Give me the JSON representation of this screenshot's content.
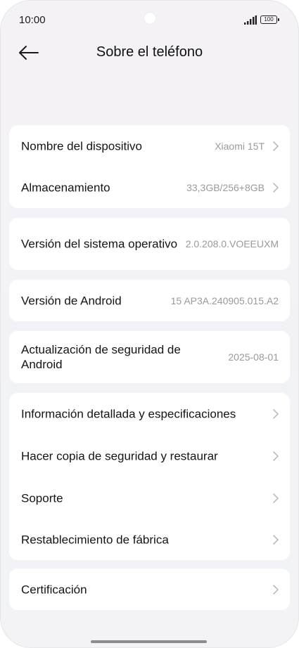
{
  "status": {
    "time": "10:00",
    "battery": "100"
  },
  "header": {
    "title": "Sobre el teléfono"
  },
  "card1": {
    "rows": [
      {
        "label": "Nombre del dispositivo",
        "value": "Xiaomi 15T"
      },
      {
        "label": "Almacenamiento",
        "value": "33,3GB/256+8GB"
      }
    ]
  },
  "os_version": {
    "label": "Versión del sistema operativo",
    "value": "2.0.208.0.VOEEUXM"
  },
  "android_version": {
    "label": "Versión de Android",
    "value": "15 AP3A.240905.015.A2"
  },
  "security_update": {
    "label": "Actualización de seguridad de Android",
    "value": "2025-08-01"
  },
  "card5": {
    "rows": [
      {
        "label": "Información detallada y especificaciones"
      },
      {
        "label": "Hacer copia de seguridad y restaurar"
      },
      {
        "label": "Soporte"
      },
      {
        "label": "Restablecimiento de fábrica"
      }
    ]
  },
  "certification": {
    "label": "Certificación"
  },
  "colors": {
    "background": "#f3f2f6",
    "card": "#ffffff",
    "text": "#141414",
    "secondary": "#9a9a9a"
  }
}
